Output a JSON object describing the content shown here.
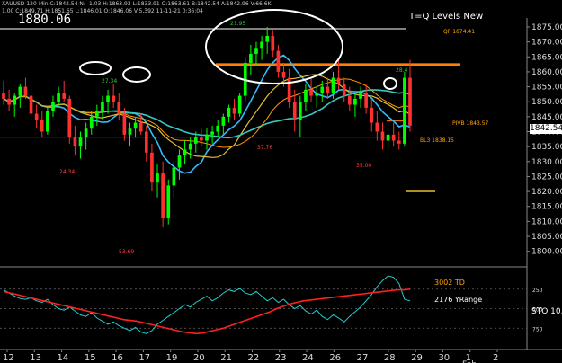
{
  "header": {
    "line1": "XAUUSD 120-Min  C:1842.54  N: -1.03  H:1863.93  L:1833.91  O:1863.61  B:1842.54  A:1842.96  V:66.6K",
    "line2": "1.00  C:1849.71  H:1851.65  L:1846.01  O:1846.06  V:5,392  11-11-21  0:36:04"
  },
  "price_display": "1880.06",
  "indicator_title": "T=Q Levels New",
  "last_price": "1842.54",
  "lower_panel": {
    "td_label": "3002 TD",
    "yrange_label": "2176 YRange",
    "sto_label": "STO 10."
  },
  "colors": {
    "background": "#000000",
    "up_candle": "#00ff00",
    "down_candle": "#ff3030",
    "ma_cyan": "#33bbff",
    "ma_yellow": "#e6c030",
    "ma_teal": "#38c8c0",
    "ma_orange": "#ff9900",
    "level_orange": "#ff8000",
    "stochastic_red": "#ff2020",
    "stochastic_cyan": "#20d0d0",
    "ellipse": "#ffffff"
  },
  "chart_data": {
    "type": "candlestick",
    "symbol": "XAUUSD",
    "timeframe": "120-Min",
    "y_ticks": [
      1875.0,
      1870.0,
      1865.0,
      1860.0,
      1855.0,
      1850.0,
      1845.0,
      1840.0,
      1835.0,
      1830.0,
      1825.0,
      1820.0,
      1815.0,
      1810.0,
      1805.0,
      1800.0
    ],
    "y_range": [
      1796,
      1878
    ],
    "x_ticks": [
      "12",
      "13",
      "14",
      "15",
      "16",
      "17",
      "19",
      "20",
      "21",
      "22",
      "23",
      "24",
      "26",
      "27",
      "28",
      "29",
      "30",
      "1",
      "2"
    ],
    "x_axis_extra": "Feb",
    "ohlc": [
      [
        1853,
        1857,
        1849,
        1851
      ],
      [
        1851,
        1854,
        1847,
        1849
      ],
      [
        1849,
        1853,
        1845,
        1852
      ],
      [
        1852,
        1856,
        1848,
        1855
      ],
      [
        1855,
        1858,
        1851,
        1852
      ],
      [
        1852,
        1855,
        1844,
        1846
      ],
      [
        1846,
        1849,
        1841,
        1844
      ],
      [
        1844,
        1847,
        1838,
        1840
      ],
      [
        1840,
        1848,
        1839,
        1847
      ],
      [
        1847,
        1852,
        1845,
        1850
      ],
      [
        1850,
        1855,
        1848,
        1853
      ],
      [
        1853,
        1857,
        1850,
        1851
      ],
      [
        1851,
        1852,
        1836,
        1838
      ],
      [
        1838,
        1842,
        1832,
        1835
      ],
      [
        1835,
        1840,
        1831,
        1838
      ],
      [
        1838,
        1843,
        1834,
        1841
      ],
      [
        1841,
        1847,
        1839,
        1845
      ],
      [
        1845,
        1849,
        1842,
        1847
      ],
      [
        1847,
        1852,
        1844,
        1850
      ],
      [
        1850,
        1854,
        1846,
        1852
      ],
      [
        1852,
        1856,
        1848,
        1850
      ],
      [
        1850,
        1853,
        1844,
        1846
      ],
      [
        1846,
        1848,
        1837,
        1839
      ],
      [
        1839,
        1843,
        1835,
        1841
      ],
      [
        1841,
        1845,
        1838,
        1843
      ],
      [
        1843,
        1846,
        1839,
        1840
      ],
      [
        1840,
        1842,
        1830,
        1833
      ],
      [
        1833,
        1836,
        1820,
        1823
      ],
      [
        1823,
        1829,
        1818,
        1826
      ],
      [
        1826,
        1830,
        1808,
        1811
      ],
      [
        1811,
        1824,
        1809,
        1822
      ],
      [
        1822,
        1830,
        1818,
        1828
      ],
      [
        1828,
        1834,
        1824,
        1832
      ],
      [
        1832,
        1837,
        1829,
        1834
      ],
      [
        1834,
        1838,
        1831,
        1836
      ],
      [
        1836,
        1840,
        1833,
        1838
      ],
      [
        1838,
        1841,
        1835,
        1837
      ],
      [
        1837,
        1841,
        1834,
        1839
      ],
      [
        1839,
        1842,
        1836,
        1840
      ],
      [
        1840,
        1844,
        1838,
        1842
      ],
      [
        1842,
        1846,
        1839,
        1845
      ],
      [
        1845,
        1849,
        1843,
        1848
      ],
      [
        1848,
        1851,
        1844,
        1846
      ],
      [
        1846,
        1853,
        1845,
        1852
      ],
      [
        1852,
        1865,
        1850,
        1863
      ],
      [
        1863,
        1869,
        1859,
        1866
      ],
      [
        1866,
        1870,
        1862,
        1868
      ],
      [
        1868,
        1872,
        1864,
        1870
      ],
      [
        1870,
        1875,
        1866,
        1872
      ],
      [
        1872,
        1874,
        1865,
        1867
      ],
      [
        1867,
        1869,
        1858,
        1860
      ],
      [
        1860,
        1863,
        1855,
        1858
      ],
      [
        1858,
        1861,
        1848,
        1850
      ],
      [
        1850,
        1854,
        1840,
        1844
      ],
      [
        1844,
        1852,
        1838,
        1850
      ],
      [
        1850,
        1856,
        1847,
        1854
      ],
      [
        1854,
        1858,
        1850,
        1852
      ],
      [
        1852,
        1855,
        1848,
        1853
      ],
      [
        1853,
        1857,
        1850,
        1855
      ],
      [
        1855,
        1858,
        1851,
        1853
      ],
      [
        1853,
        1860,
        1851,
        1858
      ],
      [
        1858,
        1864,
        1854,
        1856
      ],
      [
        1856,
        1858,
        1850,
        1852
      ],
      [
        1852,
        1855,
        1847,
        1849
      ],
      [
        1849,
        1853,
        1845,
        1851
      ],
      [
        1851,
        1855,
        1848,
        1853
      ],
      [
        1853,
        1856,
        1846,
        1848
      ],
      [
        1848,
        1851,
        1840,
        1843
      ],
      [
        1843,
        1847,
        1837,
        1840
      ],
      [
        1840,
        1843,
        1834,
        1837
      ],
      [
        1837,
        1841,
        1834,
        1839
      ],
      [
        1839,
        1843,
        1835,
        1837
      ],
      [
        1837,
        1840,
        1834,
        1836
      ],
      [
        1836,
        1860,
        1835,
        1858
      ],
      [
        1858,
        1864,
        1840,
        1842
      ]
    ],
    "levels": [
      {
        "name": "QP",
        "value": 1874.41,
        "color": "#ffffff"
      },
      {
        "name": "level-orange",
        "value": 1862.4,
        "color": "#ff8000"
      },
      {
        "name": "PIVB",
        "value": 1843.57,
        "color": "#ff8000"
      },
      {
        "name": "BL3",
        "value": 1838.15,
        "color": "#ff8000"
      }
    ],
    "annotations": [
      "QP 1874.41",
      "PIVB 1843.57",
      "BL3 1838.15",
      "24.34",
      "53.69",
      "37.76",
      "35.00",
      "27.34",
      "21.95",
      "28.4"
    ],
    "stochastic": {
      "levels": [
        250,
        500,
        750
      ],
      "red": [
        0.72,
        0.7,
        0.68,
        0.66,
        0.64,
        0.62,
        0.6,
        0.58,
        0.56,
        0.54,
        0.52,
        0.5,
        0.48,
        0.46,
        0.44,
        0.42,
        0.4,
        0.38,
        0.36,
        0.35,
        0.34,
        0.32,
        0.3,
        0.28,
        0.26,
        0.24,
        0.22,
        0.2,
        0.19,
        0.18,
        0.19,
        0.21,
        0.23,
        0.25,
        0.28,
        0.31,
        0.34,
        0.37,
        0.4,
        0.43,
        0.46,
        0.5,
        0.53,
        0.56,
        0.58,
        0.6,
        0.61,
        0.62,
        0.63,
        0.64,
        0.65,
        0.66,
        0.67,
        0.68,
        0.69,
        0.7,
        0.71,
        0.72,
        0.73,
        0.74,
        0.74,
        0.75
      ],
      "cyan": [
        0.74,
        0.7,
        0.66,
        0.63,
        0.62,
        0.64,
        0.6,
        0.58,
        0.62,
        0.55,
        0.5,
        0.48,
        0.52,
        0.47,
        0.42,
        0.4,
        0.45,
        0.38,
        0.34,
        0.3,
        0.33,
        0.28,
        0.25,
        0.22,
        0.26,
        0.2,
        0.18,
        0.22,
        0.3,
        0.35,
        0.4,
        0.45,
        0.5,
        0.55,
        0.52,
        0.58,
        0.62,
        0.66,
        0.6,
        0.64,
        0.7,
        0.74,
        0.72,
        0.76,
        0.7,
        0.68,
        0.72,
        0.66,
        0.6,
        0.64,
        0.58,
        0.62,
        0.55,
        0.5,
        0.54,
        0.47,
        0.43,
        0.48,
        0.4,
        0.36,
        0.42,
        0.38,
        0.33,
        0.4,
        0.46,
        0.52,
        0.6,
        0.68,
        0.78,
        0.86,
        0.92,
        0.9,
        0.82,
        0.62,
        0.6
      ]
    }
  }
}
